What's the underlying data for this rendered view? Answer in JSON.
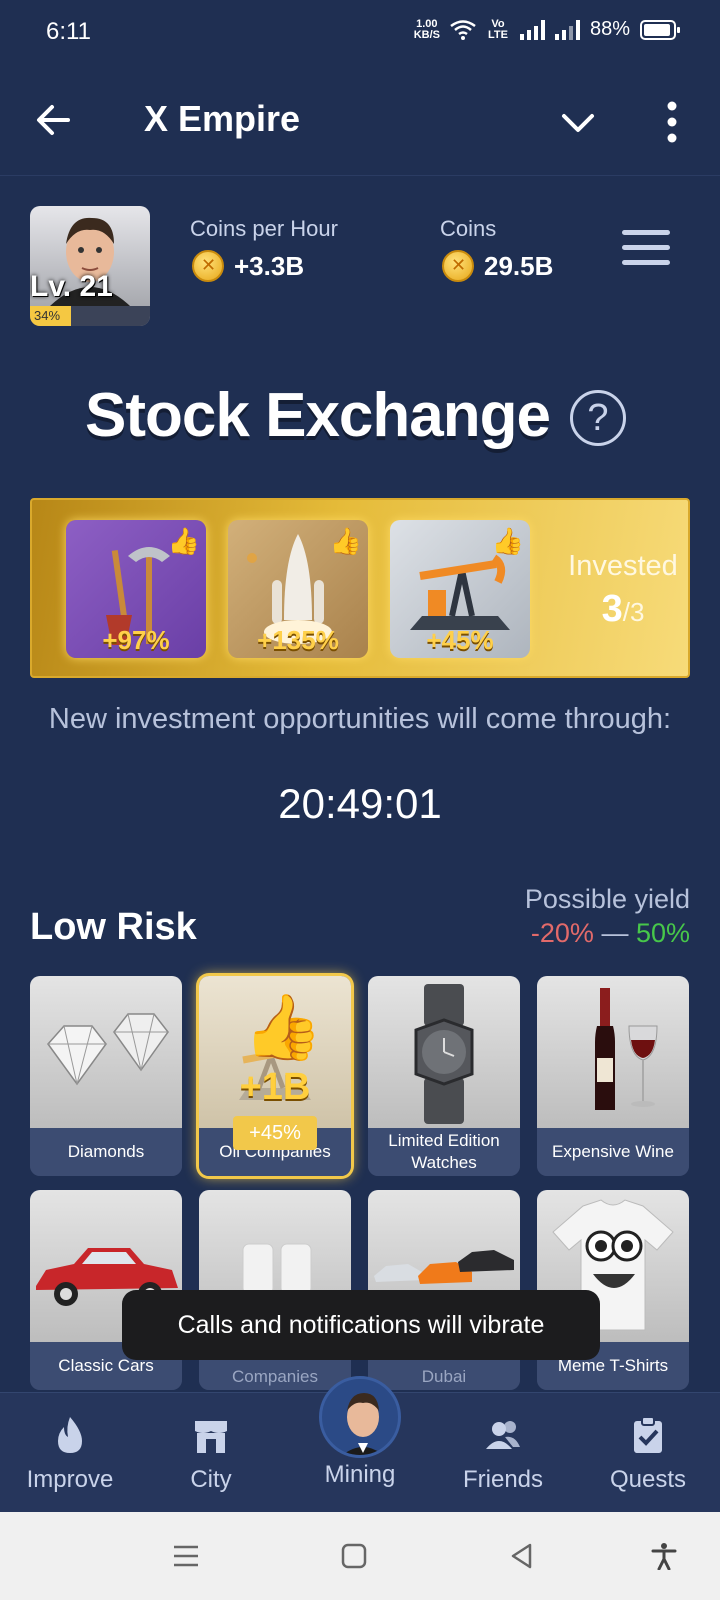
{
  "status_bar": {
    "time": "6:11",
    "net_speed_value": "1.00",
    "net_speed_unit": "KB/S",
    "volte": "Vo LTE",
    "battery": "88%"
  },
  "app_bar": {
    "title": "X Empire"
  },
  "profile": {
    "level": "Lv. 21",
    "progress_label": "34%",
    "progress": 0.34,
    "coins_per_hour_label": "Coins per Hour",
    "coins_per_hour": "+3.3B",
    "coins_label": "Coins",
    "coins": "29.5B"
  },
  "page": {
    "title": "Stock Exchange",
    "help": "?"
  },
  "invested": {
    "slots": [
      {
        "bonus": "+97%",
        "icon": "tools-icon"
      },
      {
        "bonus": "+135%",
        "icon": "rocket-icon"
      },
      {
        "bonus": "+45%",
        "icon": "oil-pump-icon"
      }
    ],
    "label": "Invested",
    "count": "3",
    "total": "/3"
  },
  "notice": {
    "text": "New investment opportunities will come through:",
    "timer": "20:49:01"
  },
  "low_risk": {
    "title": "Low Risk",
    "yield_label": "Possible yield",
    "yield_min": "-20%",
    "yield_sep": "—",
    "yield_max": "50%",
    "cards": [
      {
        "label": "Diamonds"
      },
      {
        "label": "Oil Companies",
        "boost": "+1B",
        "boost_pct": "+45%"
      },
      {
        "label": "Limited Edition Watches"
      },
      {
        "label": "Expensive Wine"
      },
      {
        "label": "Classic Cars"
      },
      {
        "label": "Pharmaceutical Companies"
      },
      {
        "label": "Car Rentals in Dubai"
      },
      {
        "label": "Meme T-Shirts"
      }
    ]
  },
  "toast": {
    "text": "Calls and notifications will vibrate"
  },
  "bottom_nav": {
    "items": [
      {
        "label": "Improve",
        "icon": "flame-icon"
      },
      {
        "label": "City",
        "icon": "store-icon"
      },
      {
        "label": "Mining",
        "icon": "avatar"
      },
      {
        "label": "Friends",
        "icon": "friends-icon"
      },
      {
        "label": "Quests",
        "icon": "clipboard-check-icon"
      }
    ]
  },
  "colors": {
    "background": "#1f2f52",
    "gold": "#f2c84a",
    "negative": "#e26a6a",
    "positive": "#47c74a"
  }
}
